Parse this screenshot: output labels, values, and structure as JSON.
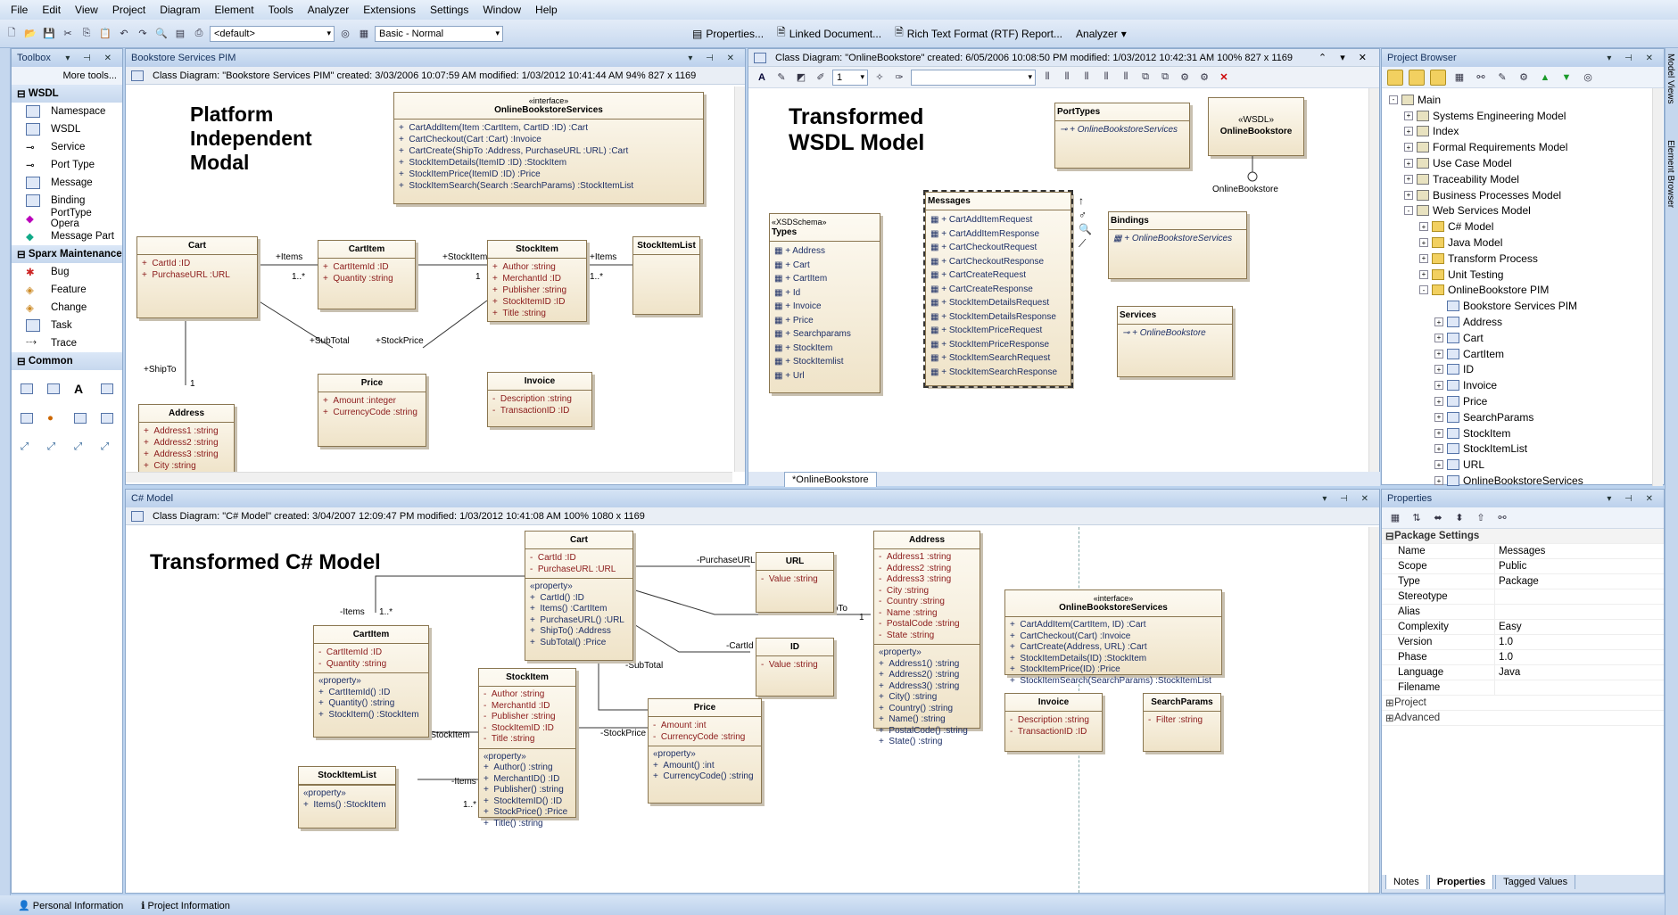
{
  "menu": [
    "File",
    "Edit",
    "View",
    "Project",
    "Diagram",
    "Element",
    "Tools",
    "Analyzer",
    "Extensions",
    "Settings",
    "Window",
    "Help"
  ],
  "toolbar": {
    "combo1": "<default>",
    "combo2": "Basic - Normal",
    "btn1": "Properties...",
    "btn2": "Linked Document...",
    "btn3": "Rich Text Format (RTF) Report...",
    "btn4": "Analyzer"
  },
  "toolbox": {
    "title": "Toolbox",
    "more": "More tools...",
    "groups": [
      {
        "name": "WSDL",
        "items": [
          "Namespace",
          "WSDL",
          "Service",
          "Port Type",
          "Message",
          "Binding",
          "PortType Opera",
          "Message Part"
        ]
      },
      {
        "name": "Sparx Maintenance",
        "items": [
          "Bug",
          "Feature",
          "Change",
          "Task",
          "Trace"
        ]
      },
      {
        "name": "Common",
        "items": []
      }
    ]
  },
  "pim": {
    "title": "Bookstore Services PIM",
    "header": "Class Diagram: \"Bookstore Services PIM\"   created: 3/03/2006 10:07:59 AM   modified: 1/03/2012 10:41:44 AM   94%   827 x 1169",
    "heading": [
      "Platform",
      "Independent",
      "Modal"
    ]
  },
  "wsdl": {
    "header": "Class Diagram: \"OnlineBookstore\"   created: 6/05/2006 10:08:50 PM   modified: 1/03/2012 10:42:31 AM   100%   827 x 1169",
    "heading": [
      "Transformed",
      "WSDL Model"
    ],
    "tab": "*OnlineBookstore",
    "zoom": "1"
  },
  "cs": {
    "title": "C# Model",
    "header": "Class Diagram: \"C# Model\"   created: 3/04/2007 12:09:47 PM   modified: 1/03/2012 10:41:08 AM   100%   1080 x 1169",
    "heading": "Transformed C# Model"
  },
  "browser": {
    "title": "Project Browser",
    "items": [
      {
        "label": "Main",
        "lvl": 0,
        "ic": "pkg",
        "exp": "-"
      },
      {
        "label": "Systems Engineering Model",
        "lvl": 1,
        "ic": "pkg",
        "exp": "+"
      },
      {
        "label": "Index",
        "lvl": 1,
        "ic": "pkg",
        "exp": "+"
      },
      {
        "label": "Formal Requirements Model",
        "lvl": 1,
        "ic": "pkg",
        "exp": "+"
      },
      {
        "label": "Use Case Model",
        "lvl": 1,
        "ic": "pkg",
        "exp": "+"
      },
      {
        "label": "Traceability Model",
        "lvl": 1,
        "ic": "pkg",
        "exp": "+"
      },
      {
        "label": "Business Processes Model",
        "lvl": 1,
        "ic": "pkg",
        "exp": "+"
      },
      {
        "label": "Web Services Model",
        "lvl": 1,
        "ic": "pkg",
        "exp": "-"
      },
      {
        "label": "C# Model",
        "lvl": 2,
        "ic": "fold",
        "exp": "+"
      },
      {
        "label": "Java Model",
        "lvl": 2,
        "ic": "fold",
        "exp": "+"
      },
      {
        "label": "Transform Process",
        "lvl": 2,
        "ic": "fold",
        "exp": "+"
      },
      {
        "label": "Unit Testing",
        "lvl": 2,
        "ic": "fold",
        "exp": "+"
      },
      {
        "label": "OnlineBookstore PIM",
        "lvl": 2,
        "ic": "fold",
        "exp": "-"
      },
      {
        "label": "Bookstore Services PIM",
        "lvl": 3,
        "ic": "pg",
        "exp": ""
      },
      {
        "label": "Address",
        "lvl": 3,
        "ic": "pg",
        "exp": "+"
      },
      {
        "label": "Cart",
        "lvl": 3,
        "ic": "pg",
        "exp": "+"
      },
      {
        "label": "CartItem",
        "lvl": 3,
        "ic": "pg",
        "exp": "+"
      },
      {
        "label": "ID",
        "lvl": 3,
        "ic": "pg",
        "exp": "+"
      },
      {
        "label": "Invoice",
        "lvl": 3,
        "ic": "pg",
        "exp": "+"
      },
      {
        "label": "Price",
        "lvl": 3,
        "ic": "pg",
        "exp": "+"
      },
      {
        "label": "SearchParams",
        "lvl": 3,
        "ic": "pg",
        "exp": "+"
      },
      {
        "label": "StockItem",
        "lvl": 3,
        "ic": "pg",
        "exp": "+"
      },
      {
        "label": "StockItemList",
        "lvl": 3,
        "ic": "pg",
        "exp": "+"
      },
      {
        "label": "URL",
        "lvl": 3,
        "ic": "pg",
        "exp": "+"
      },
      {
        "label": "OnlineBookstoreServices",
        "lvl": 3,
        "ic": "pg",
        "exp": "+"
      }
    ]
  },
  "properties": {
    "title": "Properties",
    "group": "Package Settings",
    "rows": [
      [
        "Name",
        "Messages"
      ],
      [
        "Scope",
        "Public"
      ],
      [
        "Type",
        "Package"
      ],
      [
        "Stereotype",
        ""
      ],
      [
        "Alias",
        ""
      ],
      [
        "Complexity",
        "Easy"
      ],
      [
        "Version",
        "1.0"
      ],
      [
        "Phase",
        "1.0"
      ],
      [
        "Language",
        "Java"
      ],
      [
        "Filename",
        ""
      ]
    ],
    "collapsed": [
      "Project",
      "Advanced"
    ],
    "tabs": [
      "Notes",
      "Properties",
      "Tagged Values"
    ]
  },
  "status": [
    "Personal Information",
    "Project Information"
  ],
  "side": [
    "Model Views",
    "Element Browser"
  ]
}
